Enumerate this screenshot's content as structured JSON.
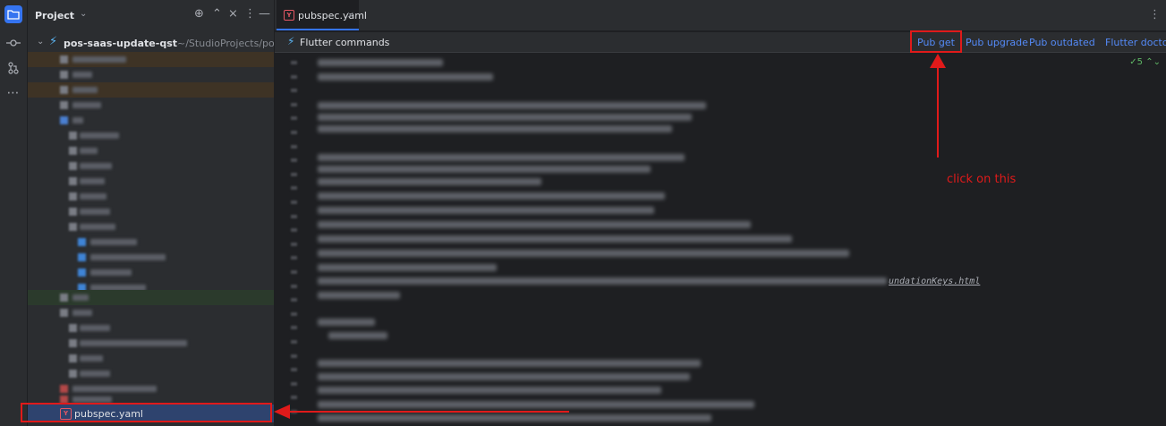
{
  "project_panel": {
    "title": "Project",
    "root": {
      "name": "pos-saas-update-qst",
      "path": "~/StudioProjects/pos-saas-updat"
    },
    "selected_file": "pubspec.yaml"
  },
  "editor": {
    "tab": {
      "label": "pubspec.yaml"
    },
    "flutter_bar": {
      "title": "Flutter commands",
      "commands": [
        "Pub get",
        "Pub upgrade",
        "Pub outdated",
        "Flutter doctor"
      ]
    },
    "inspection_count": "5",
    "visible_code_fragment": "undationKeys.html"
  },
  "annotation": {
    "text": "click on this",
    "color": "#e01a1a"
  },
  "colors": {
    "accent": "#3574f0",
    "link": "#548af7",
    "selection": "#2e436e"
  }
}
